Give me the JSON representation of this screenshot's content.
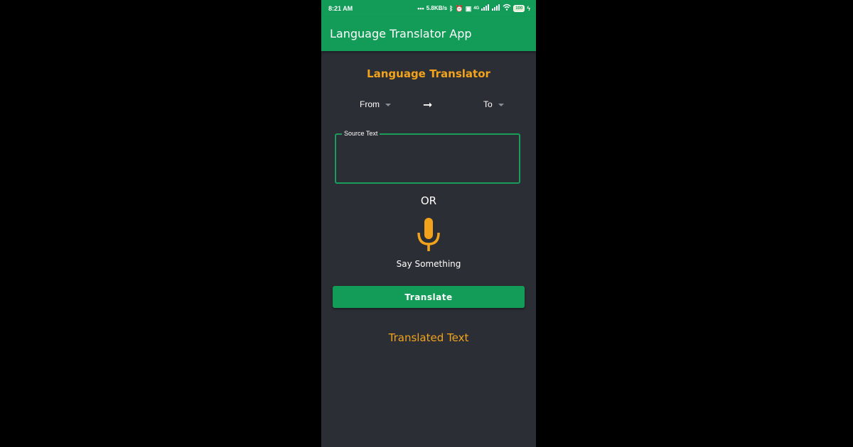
{
  "status_bar": {
    "time": "8:21 AM",
    "network_speed": "5.8KB/s",
    "signal_label": "4G",
    "battery": "100",
    "icons": [
      "dots-icon",
      "bluetooth-icon",
      "alarm-icon",
      "vo-icon",
      "signal-icon",
      "signal-icon",
      "wifi-icon",
      "battery-icon",
      "charging-icon"
    ]
  },
  "app_bar": {
    "title": "Language Translator App"
  },
  "main": {
    "heading": "Language Translator",
    "from_label": "From",
    "to_label": "To",
    "arrow": "➞",
    "source_label": "Source Text",
    "source_value": "",
    "or_label": "OR",
    "mic_icon": "microphone-icon",
    "say_label": "Say Something",
    "translate_button": "Translate",
    "translated_text": "Translated Text"
  },
  "colors": {
    "primary": "#139c57",
    "accent": "#f2a31b",
    "background": "#2b2f35",
    "outer": "#000000"
  }
}
